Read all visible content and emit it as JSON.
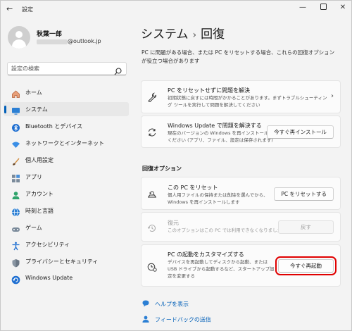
{
  "window": {
    "title": "設定"
  },
  "user": {
    "name": "秋葉一郎",
    "email_suffix": "@outlook.jp"
  },
  "search": {
    "placeholder": "設定の検索"
  },
  "sidebar": {
    "items": [
      {
        "label": "ホーム",
        "icon": "home-icon"
      },
      {
        "label": "システム",
        "icon": "system-icon"
      },
      {
        "label": "Bluetooth とデバイス",
        "icon": "bluetooth-icon"
      },
      {
        "label": "ネットワークとインターネット",
        "icon": "network-icon"
      },
      {
        "label": "個人用設定",
        "icon": "brush-icon"
      },
      {
        "label": "アプリ",
        "icon": "apps-icon"
      },
      {
        "label": "アカウント",
        "icon": "account-icon"
      },
      {
        "label": "時刻と言語",
        "icon": "globe-icon"
      },
      {
        "label": "ゲーム",
        "icon": "game-icon"
      },
      {
        "label": "アクセシビリティ",
        "icon": "accessibility-icon"
      },
      {
        "label": "プライバシーとセキュリティ",
        "icon": "shield-icon"
      },
      {
        "label": "Windows Update",
        "icon": "update-icon"
      }
    ],
    "active_index": 1
  },
  "breadcrumb": {
    "parent": "システム",
    "separator": "›",
    "current": "回復"
  },
  "page": {
    "description": "PC に問題がある場合、または PC をリセットする場合、これらの回復オプションが役立つ場合があります"
  },
  "cards": {
    "troubleshoot": {
      "title": "PC をリセットせずに問題を解決",
      "subtitle": "初期状態に戻すには時間がかかることがあります。まずトラブルシューティング ツールを実行して問題を解決してください"
    },
    "windows_update": {
      "title": "Windows Update で問題を解決する",
      "subtitle": "現在のバージョンの Windows を再インストールして ください (アプリ、ファイル、設定は保存されます)",
      "button": "今すぐ再インストール"
    },
    "reset": {
      "title": "この PC をリセット",
      "subtitle": "個人用ファイルの保持または削除を選んでから、 Windows を再インストールします",
      "button": "PC をリセットする"
    },
    "restore": {
      "title": "復元",
      "subtitle": "このオプションはこの PC では利用できなくなりました",
      "button": "戻す"
    },
    "startup": {
      "title": "PC の起動をカスタマイズする",
      "subtitle": "デバイスを再起動してディスクから起動、または USB ドライブから起動するなど、スタートアップ設定を変更する",
      "button": "今すぐ再起動"
    }
  },
  "section": {
    "recovery_options": "回復オプション"
  },
  "links": {
    "help": "ヘルプを表示",
    "feedback": "フィードバックの送信"
  },
  "colors": {
    "accent": "#005fb8",
    "highlight": "#e00000"
  }
}
